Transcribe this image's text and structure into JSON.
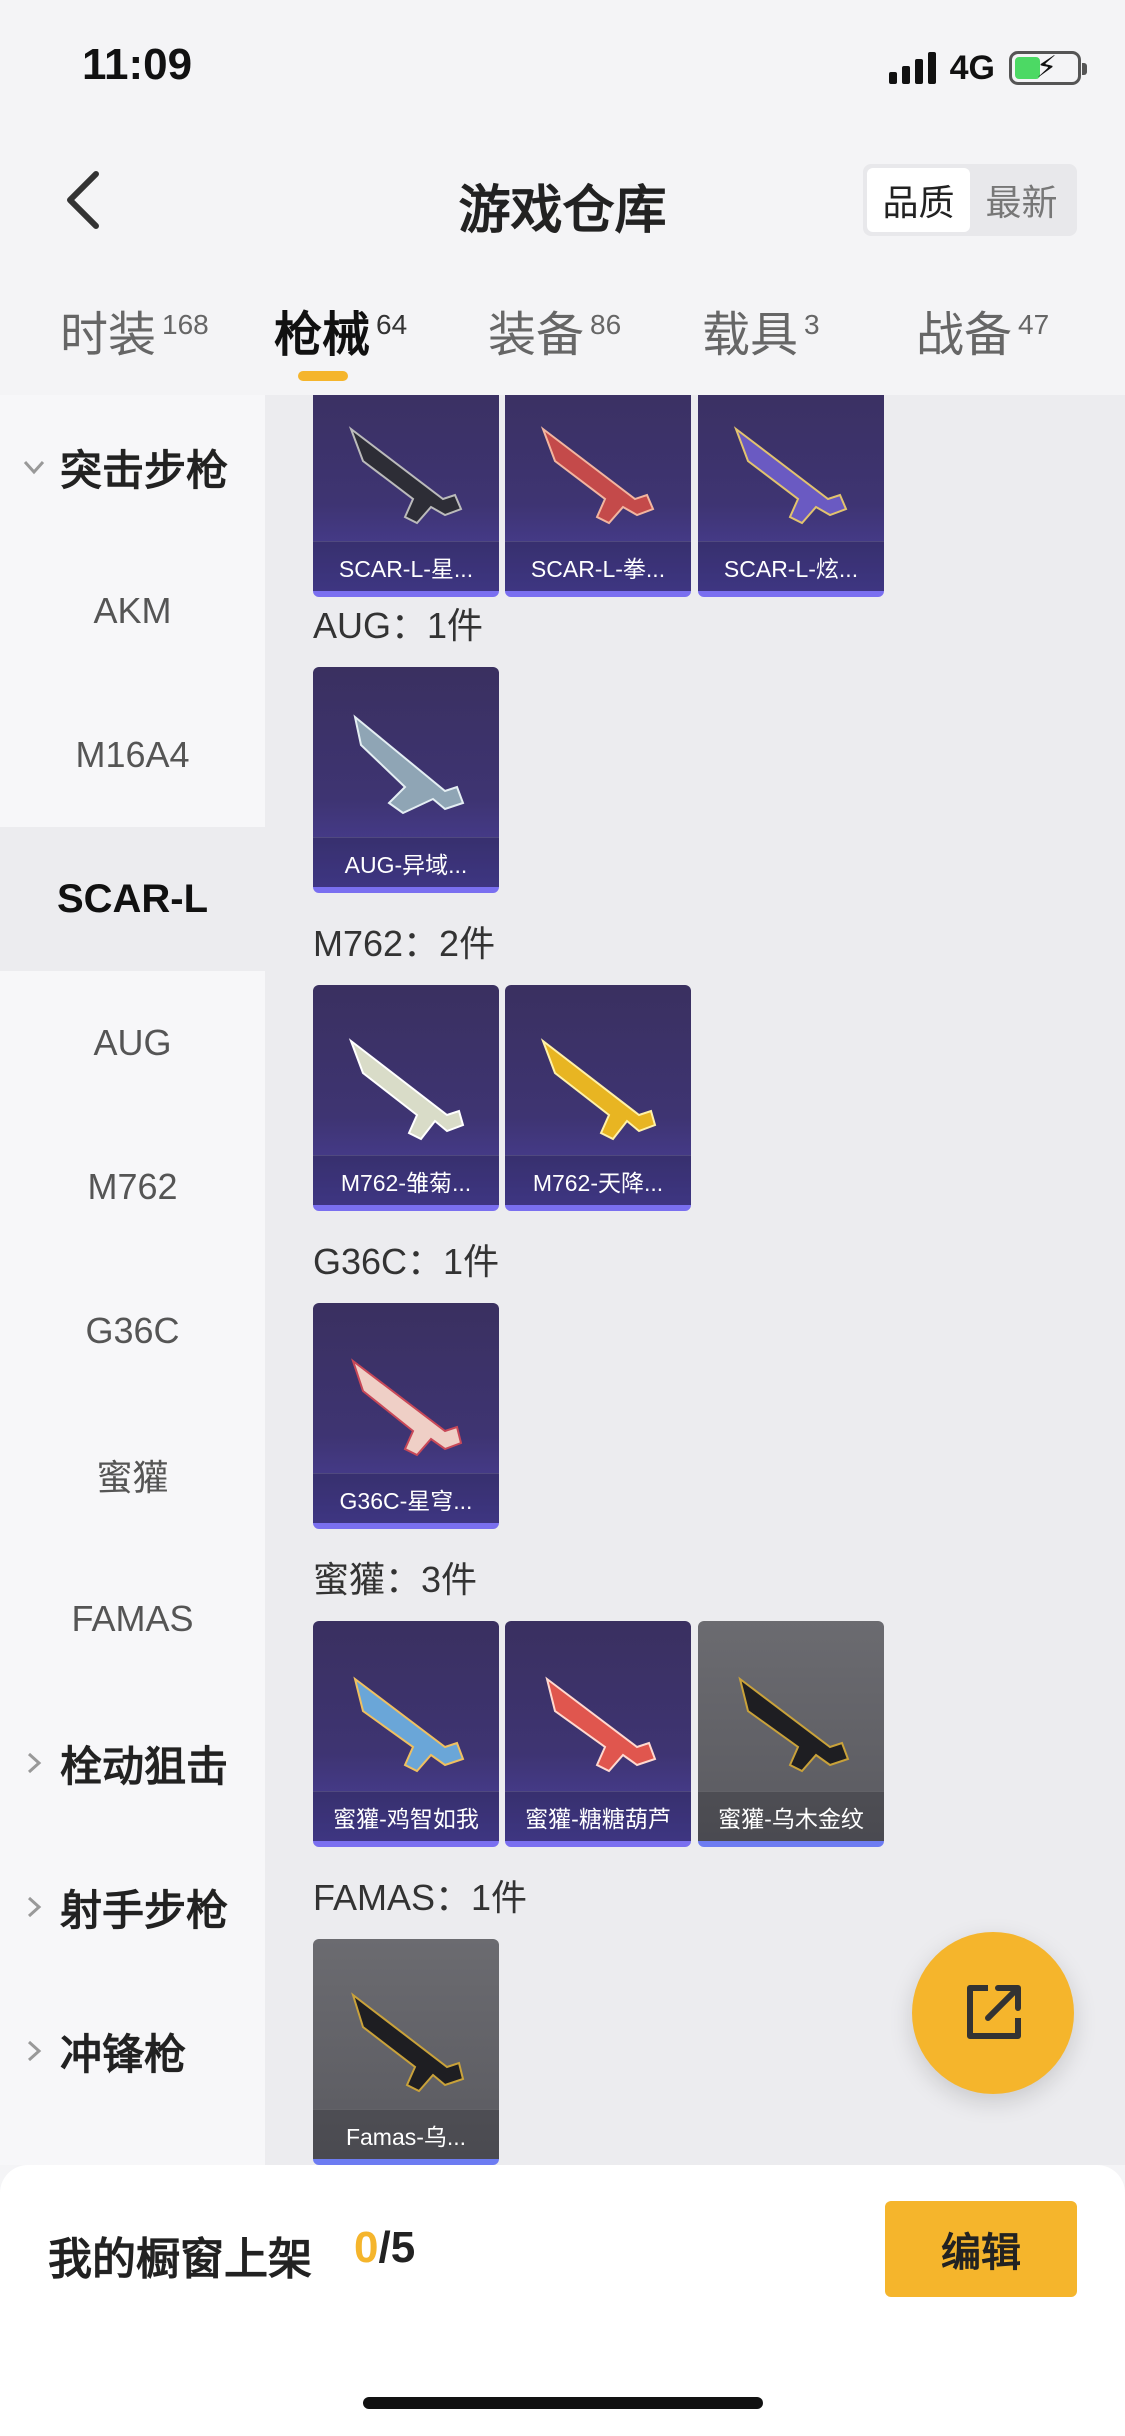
{
  "status_bar": {
    "time": "11:09",
    "network": "4G"
  },
  "header": {
    "title": "游戏仓库",
    "sort_options": [
      "品质",
      "最新"
    ],
    "sort_active": "品质"
  },
  "tabs": [
    {
      "label": "时装",
      "count": "168"
    },
    {
      "label": "枪械",
      "count": "64"
    },
    {
      "label": "装备",
      "count": "86"
    },
    {
      "label": "载具",
      "count": "3"
    },
    {
      "label": "战备",
      "count": "47"
    }
  ],
  "active_tab": "枪械",
  "sidebar": {
    "groups": [
      {
        "label": "突击步枪",
        "expanded": true
      },
      {
        "label": "栓动狙击",
        "expanded": false
      },
      {
        "label": "射手步枪",
        "expanded": false
      },
      {
        "label": "冲锋枪",
        "expanded": false
      }
    ],
    "items": [
      "AKM",
      "M16A4",
      "SCAR-L",
      "AUG",
      "M762",
      "G36C",
      "蜜獾",
      "FAMAS"
    ],
    "active_item": "SCAR-L"
  },
  "sections": [
    {
      "label": "",
      "items": [
        {
          "name": "SCAR-L-星...",
          "rarity": "purple"
        },
        {
          "name": "SCAR-L-拳...",
          "rarity": "purple"
        },
        {
          "name": "SCAR-L-炫...",
          "rarity": "purple"
        }
      ]
    },
    {
      "label": "AUG：1件",
      "items": [
        {
          "name": "AUG-异域...",
          "rarity": "purple"
        }
      ]
    },
    {
      "label": "M762：2件",
      "items": [
        {
          "name": "M762-雏菊...",
          "rarity": "purple"
        },
        {
          "name": "M762-天降...",
          "rarity": "purple"
        }
      ]
    },
    {
      "label": "G36C：1件",
      "items": [
        {
          "name": "G36C-星穹...",
          "rarity": "purple"
        }
      ]
    },
    {
      "label": "蜜獾：3件",
      "items": [
        {
          "name": "蜜獾-鸡智如我",
          "rarity": "purple"
        },
        {
          "name": "蜜獾-糖糖葫芦",
          "rarity": "purple"
        },
        {
          "name": "蜜獾-乌木金纹",
          "rarity": "gray"
        }
      ]
    },
    {
      "label": "FAMAS：1件",
      "items": [
        {
          "name": "Famas-乌...",
          "rarity": "gray"
        }
      ]
    }
  ],
  "bottom_bar": {
    "showcase_label": "我的橱窗上架",
    "current": "0",
    "total": "/5",
    "edit_label": "编辑"
  },
  "colors": {
    "accent": "#f5b52c",
    "card_purple": "#3e3472",
    "card_gray": "#5a5a60"
  },
  "icons": {
    "back": "chevron-left-icon",
    "share": "share-external-icon"
  }
}
